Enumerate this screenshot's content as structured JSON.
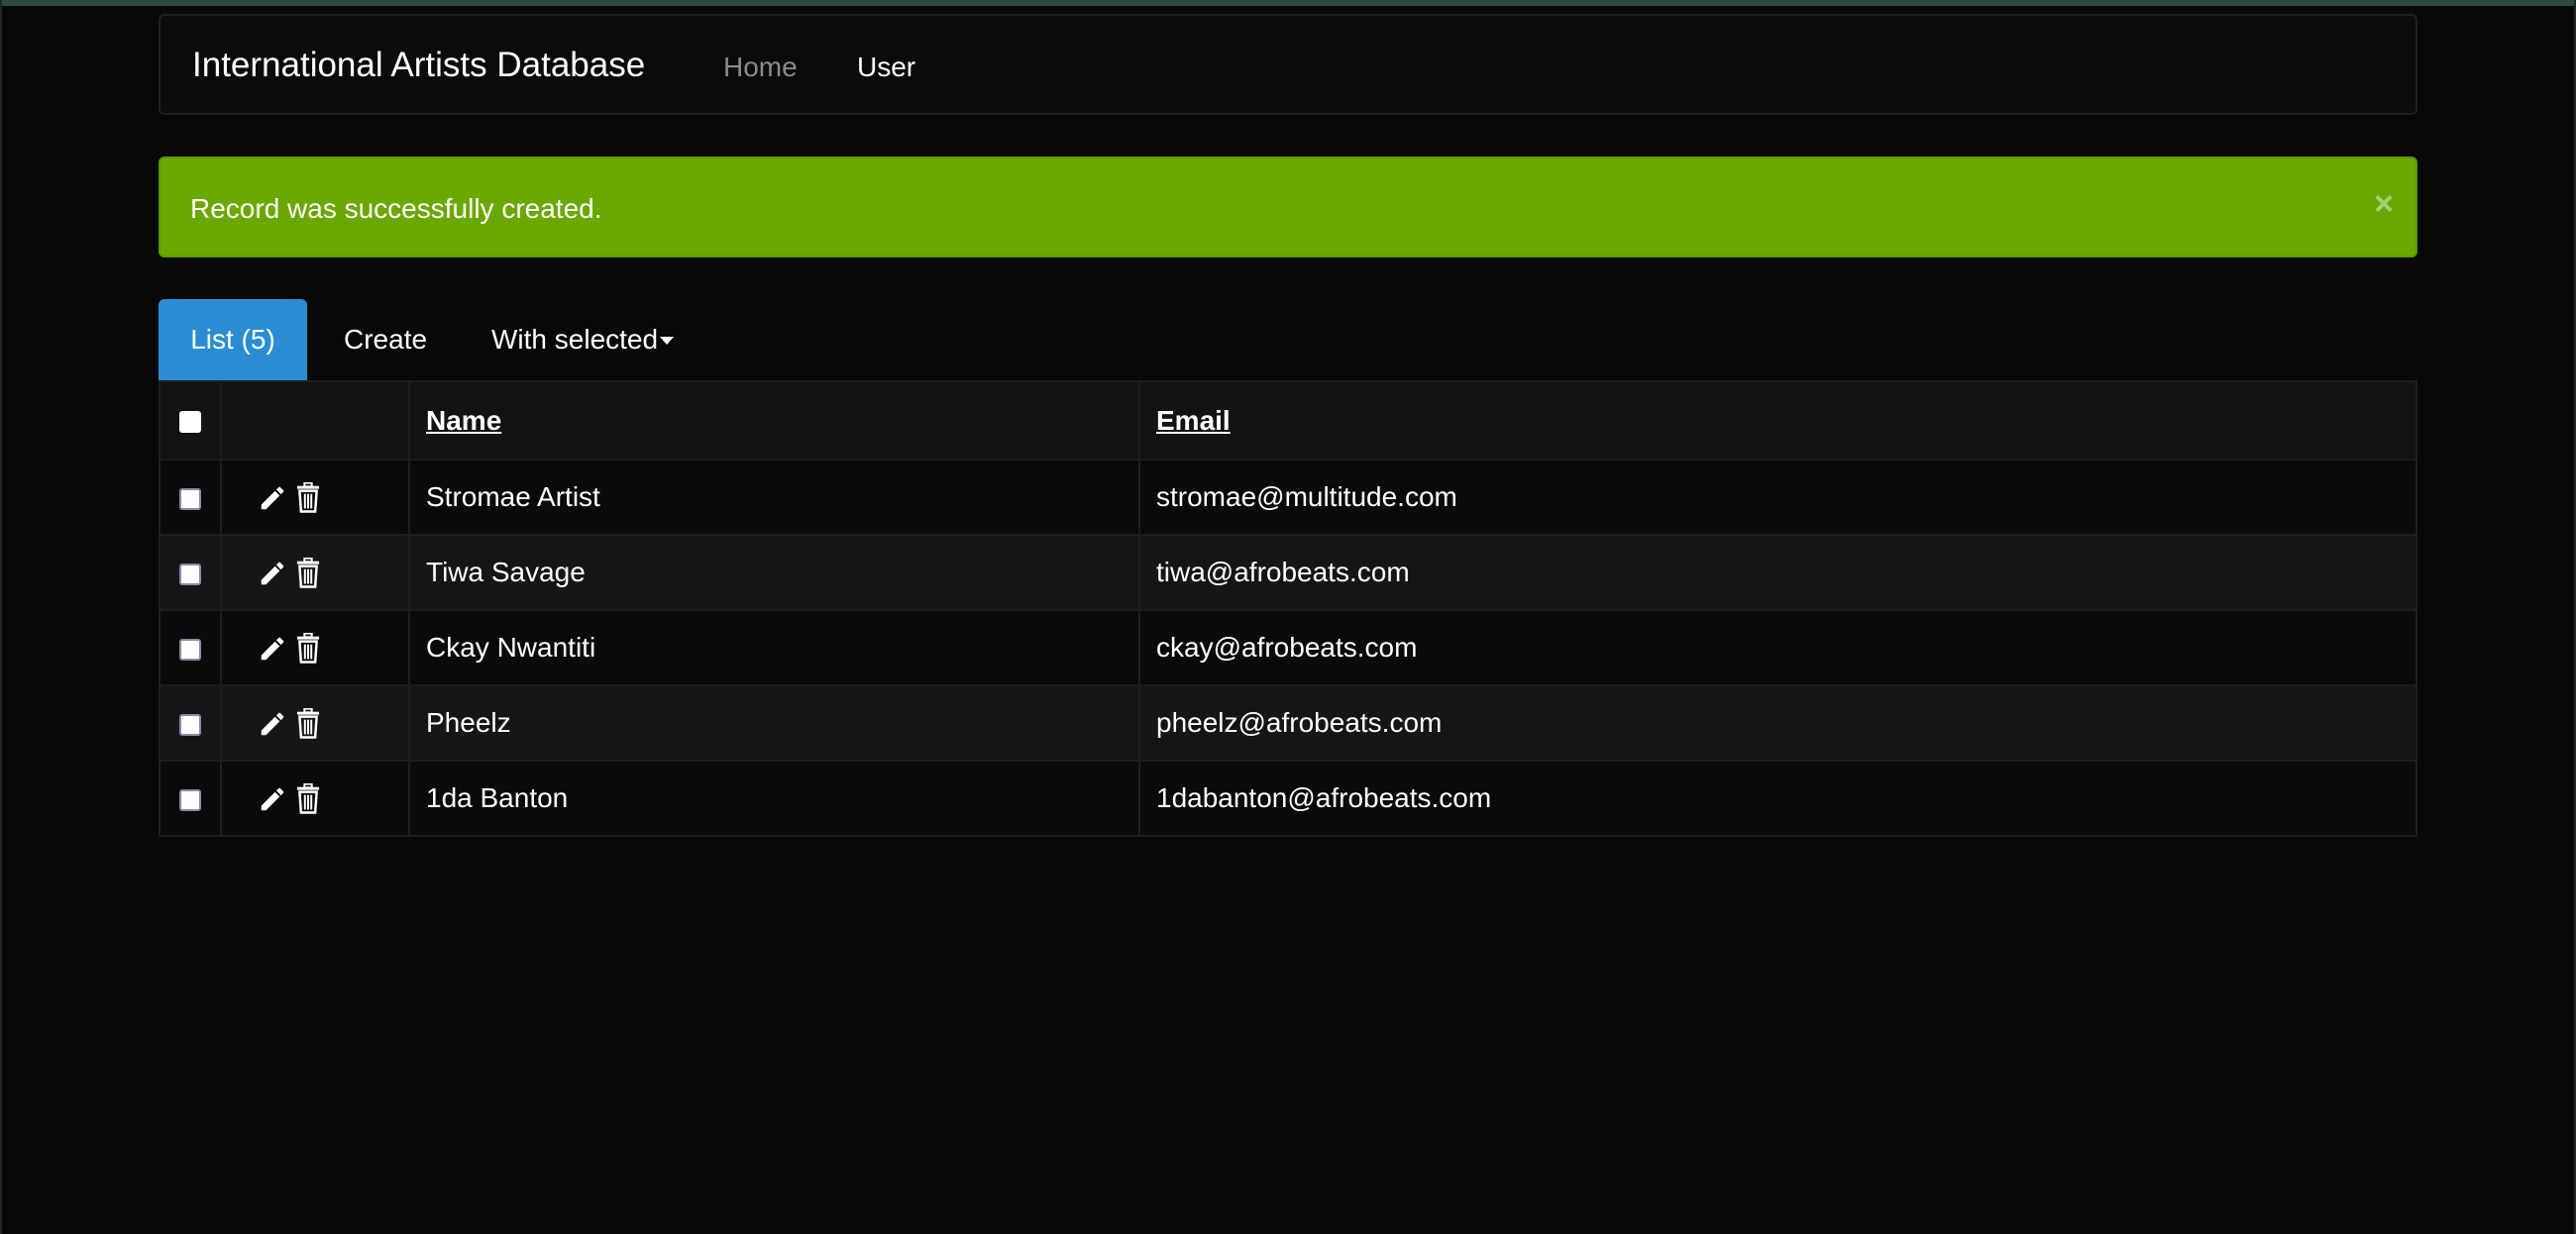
{
  "app": {
    "brand": "International Artists Database"
  },
  "nav": {
    "home": "Home",
    "user": "User"
  },
  "alert": {
    "message": "Record was successfully created.",
    "close": "×",
    "color": "#6aa800"
  },
  "tabs": {
    "list": "List (5)",
    "create": "Create",
    "with_selected": "With selected"
  },
  "table": {
    "columns": {
      "name": "Name",
      "email": "Email"
    },
    "rows": [
      {
        "name": "Stromae Artist",
        "email": "stromae@multitude.com"
      },
      {
        "name": "Tiwa Savage",
        "email": "tiwa@afrobeats.com"
      },
      {
        "name": "Ckay Nwantiti",
        "email": "ckay@afrobeats.com"
      },
      {
        "name": "Pheelz",
        "email": "pheelz@afrobeats.com"
      },
      {
        "name": "1da Banton",
        "email": "1dabanton@afrobeats.com"
      }
    ],
    "row_icons": [
      "pencil-icon",
      "trash-icon"
    ]
  },
  "colors": {
    "background": "#080808",
    "active_tab": "#2a8dd4",
    "muted_link": "#8a8a8a"
  }
}
